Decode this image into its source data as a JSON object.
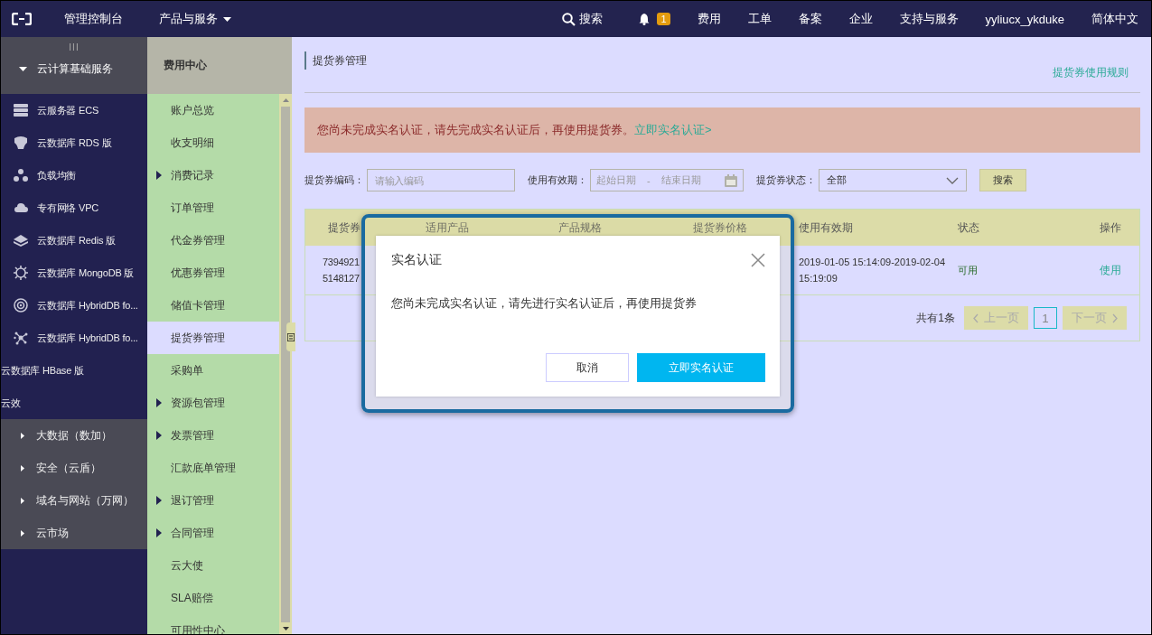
{
  "topbar": {
    "console": "管理控制台",
    "products": "产品与服务",
    "search": "搜索",
    "notifications": "1",
    "links": [
      "费用",
      "工单",
      "备案",
      "企业",
      "支持与服务",
      "yyliucx_ykduke",
      "简体中文"
    ]
  },
  "sidebar": {
    "handle": "III",
    "group": {
      "label": "云计算基础服务",
      "expanded": true
    },
    "items": [
      {
        "label": "云服务器 ECS",
        "kind": "service"
      },
      {
        "label": "云数据库 RDS 版",
        "kind": "service"
      },
      {
        "label": "负载均衡",
        "kind": "service"
      },
      {
        "label": "专有网络 VPC",
        "kind": "service"
      },
      {
        "label": "云数据库 Redis 版",
        "kind": "service"
      },
      {
        "label": "云数据库 MongoDB 版",
        "kind": "service"
      },
      {
        "label": "云数据库 HybridDB fo...",
        "kind": "service"
      },
      {
        "label": "云数据库 HybridDB fo...",
        "kind": "service"
      },
      {
        "label": "云数据库 HBase 版",
        "kind": "plain"
      },
      {
        "label": "云效",
        "kind": "plain"
      }
    ],
    "groups": [
      {
        "label": "大数据（数加）",
        "expanded": false
      },
      {
        "label": "安全（云盾）",
        "expanded": false
      },
      {
        "label": "域名与网站（万网）",
        "expanded": false
      },
      {
        "label": "云市场",
        "expanded": false
      }
    ]
  },
  "subnav": {
    "title": "费用中心",
    "items": [
      {
        "label": "账户总览",
        "selected": false
      },
      {
        "label": "收支明细",
        "selected": false
      },
      {
        "label": "消费记录",
        "selected": false,
        "expanded": false
      },
      {
        "label": "订单管理",
        "selected": false
      },
      {
        "label": "代金券管理",
        "selected": false
      },
      {
        "label": "优惠券管理",
        "selected": false
      },
      {
        "label": "储值卡管理",
        "selected": false
      },
      {
        "label": "提货券管理",
        "selected": true
      },
      {
        "label": "采购单",
        "selected": false
      },
      {
        "label": "资源包管理",
        "selected": false,
        "expanded": false
      },
      {
        "label": "发票管理",
        "selected": false,
        "expanded": false
      },
      {
        "label": "汇款底单管理",
        "selected": false
      },
      {
        "label": "退订管理",
        "selected": false,
        "expanded": false
      },
      {
        "label": "合同管理",
        "selected": false,
        "expanded": false
      },
      {
        "label": "云大使",
        "selected": false
      },
      {
        "label": "SLA赔偿",
        "selected": false
      },
      {
        "label": "可用性中心",
        "selected": false
      }
    ]
  },
  "page": {
    "title": "提货券管理",
    "rules_link": "提货券使用规则",
    "alert": {
      "text": "您尚未完成实名认证，请先完成实名认证后，再使用提货券。",
      "link": "立即实名认证>"
    },
    "filters": {
      "code_label": "提货券编码：",
      "code_placeholder": "请输入编码",
      "period_label": "使用有效期：",
      "start_placeholder": "起始日期",
      "separator": "-",
      "end_placeholder": "结束日期",
      "status_label": "提货券状态：",
      "status_value": "全部",
      "search_button": "搜索"
    },
    "table": {
      "columns": [
        "提货券",
        "适用产品",
        "产品规格",
        "提货券价格",
        "使用有效期",
        "状态",
        "操作"
      ],
      "rows": [
        {
          "code": [
            "7394921",
            "5148127"
          ],
          "period": [
            "2019-01-05 15:14:09-2019-02-04",
            "15:19:09"
          ],
          "status": "可用",
          "action": "使用"
        }
      ]
    },
    "pagination": {
      "total": "共有1条",
      "prev": {
        "label": "上一页",
        "disabled": true
      },
      "pages": [
        {
          "label": "1",
          "selected": true
        }
      ],
      "next": {
        "label": "下一页",
        "disabled": true
      }
    }
  },
  "dialog": {
    "title": "实名认证",
    "message": "您尚未完成实名认证，请先进行实名认证后，再使用提货券",
    "buttons": [
      {
        "label": "取消",
        "kind": "secondary"
      },
      {
        "label": "立即实名认证",
        "kind": "primary"
      }
    ]
  }
}
